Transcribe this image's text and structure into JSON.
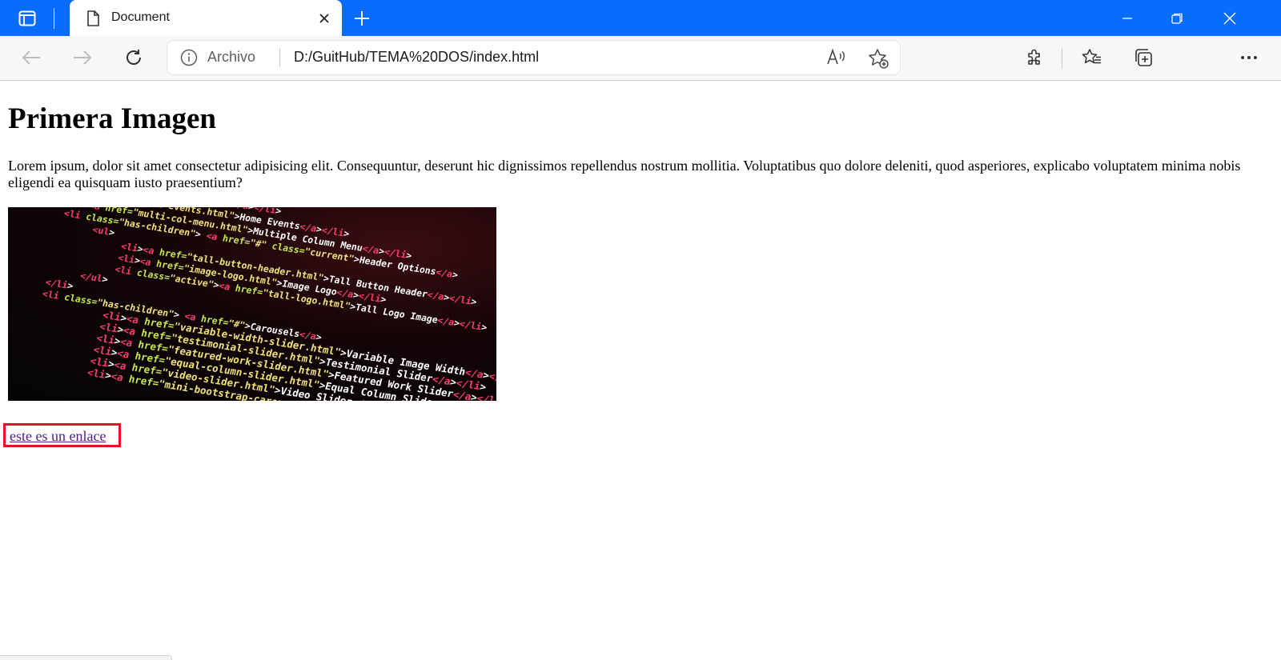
{
  "browser": {
    "tab": {
      "title": "Document"
    },
    "address": {
      "site_label": "Archivo",
      "url": "D:/GuitHub/TEMA%20DOS/index.html"
    },
    "colors": {
      "titlebar": "#0a6cff",
      "link_outline": "#e81123"
    },
    "icons": [
      "tab-actions-icon",
      "document-icon",
      "close-icon",
      "plus-icon",
      "minimize-icon",
      "restore-icon",
      "window-close-icon",
      "back-icon",
      "forward-icon",
      "refresh-icon",
      "info-icon",
      "read-aloud-icon",
      "add-favorite-icon",
      "extensions-icon",
      "favorites-icon",
      "collections-icon",
      "more-icon"
    ]
  },
  "page": {
    "heading": "Primera Imagen",
    "paragraph": "Lorem ipsum, dolor sit amet consectetur adipisicing elit. Consequuntur, deserunt hic dignissimos repellendus nostrum mollitia. Voluptatibus quo dolore deleniti, quod asperiores, explicabo voluptatem minima nobis eligendi ea quisquam iusto praesentium?",
    "image": {
      "code_lines": [
        "<li><a href=\"index.html\">Home</a></li>",
        "<li><a href=\"home-events.html\">Home Events</a></li>",
        "<li><a href=\"multi-col-menu.html\">Multiple Column Menu</a></li>",
        "<li class=\"has-children\"> <a href=\"#\" class=\"current\">Header Options</a>",
        "<ul>",
        "<li><a href=\"tall-button-header.html\">Tall Button Header</a></li>",
        "<li><a href=\"image-logo.html\">Image Logo</a></li>",
        "<li class=\"active\"><a href=\"tall-logo.html\">Tall Logo Image</a></li>",
        "</ul>",
        "</li>",
        "<li class=\"has-children\"> <a href=\"#\">Carousels</a>",
        "<li><a href=\"variable-width-slider.html\">Variable Image Width</a></li>",
        "<li><a href=\"testimonial-slider.html\">Testimonial Slider</a></li>",
        "<li><a href=\"featured-work-slider.html\">Featured Work Slider</a></li>",
        "<li><a href=\"equal-column-slider.html\">Equal Column Slider</a></li>",
        "<li><a href=\"video-slider.html\">Video Slider</a></li>",
        "<li><a href=\"mini-bootstrap-carousel.html\">Mini Slider</a></li>"
      ]
    },
    "link_text": "este es un enlace"
  }
}
